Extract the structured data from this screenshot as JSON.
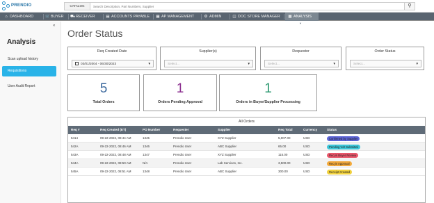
{
  "brand": {
    "name": "PRENDIO"
  },
  "search": {
    "catalog_label": "CATALOG",
    "placeholder": "Search Description, Part Numbers, Supplier"
  },
  "nav": [
    {
      "label": "DASHBOARD",
      "icon": "home-icon"
    },
    {
      "label": "BUYER",
      "icon": "cart-icon"
    },
    {
      "label": "RECEIVER",
      "icon": "truck-icon"
    },
    {
      "label": "ACCOUNTS PAYABLE",
      "icon": "invoice-icon"
    },
    {
      "label": "AP MANAGEMENT",
      "icon": "document-icon"
    },
    {
      "label": "ADMIN",
      "icon": "gear-icon"
    },
    {
      "label": "DOC STORE MANAGER",
      "icon": "folder-icon"
    },
    {
      "label": "ANALYSIS",
      "icon": "bar-chart-icon",
      "active": true
    }
  ],
  "sidebar": {
    "title": "Analysis",
    "items": [
      {
        "label": "Scan upload history"
      },
      {
        "label": "Requisitions",
        "active": true
      },
      {
        "label": "User Audit Report"
      }
    ]
  },
  "page": {
    "title": "Order Status"
  },
  "filters": {
    "req_created_date": {
      "label": "Req Created Date",
      "value": "03/01/2004 - 06/30/2023"
    },
    "suppliers": {
      "label": "Supplier(s)",
      "placeholder": "Select..."
    },
    "requestor": {
      "label": "Requestor",
      "placeholder": "Select..."
    },
    "order_status": {
      "label": "Order Status",
      "placeholder": "Select..."
    }
  },
  "cards": [
    {
      "value": "5",
      "label": "Total Orders",
      "color": "#3d6a9e"
    },
    {
      "value": "1",
      "label": "Orders Pending Approval",
      "color": "#8b2f8f"
    },
    {
      "value": "1",
      "label": "Orders in Buyer/Supplier Processing",
      "color": "#2e9a72"
    }
  ],
  "table": {
    "caption": "All Orders",
    "columns": [
      "Req #",
      "Req Created (ET)",
      "PO Number",
      "Requester",
      "Supplier",
      "Req Total",
      "Currency",
      "Status"
    ],
    "rows": [
      {
        "req": "5414",
        "created": "09-22-2022, 08:44 AM",
        "po": "1345",
        "requester": "Prendio User",
        "supplier": "XYZ Supplier",
        "total": "5,007.00",
        "currency": "USD",
        "status": "Confirmed by Supplier",
        "status_color": "#5c64d6"
      },
      {
        "req": "542A",
        "created": "09-22-2022, 08:46 AM",
        "po": "1346",
        "requester": "Prendio User",
        "supplier": "ABC Supplier",
        "total": "65.00",
        "currency": "USD",
        "status": "Pending Vdr Submittal",
        "status_color": "#3cc6d8"
      },
      {
        "req": "543A",
        "created": "09-22-2022, 08:48 AM",
        "po": "1347",
        "requester": "Prendio User",
        "supplier": "XYZ Supplier",
        "total": "115.00",
        "currency": "USD",
        "status": "Req in Buyer Review",
        "status_color": "#e8566a"
      },
      {
        "req": "544A",
        "created": "09-22-2022, 08:50 AM",
        "po": "N/A",
        "requester": "Prendio User",
        "supplier": "Lab Services, Inc.",
        "total": "3,500.00",
        "currency": "USD",
        "status": "Req in Approval",
        "status_color": "#f3a93a"
      },
      {
        "req": "545A",
        "created": "09-22-2022, 08:51 AM",
        "po": "1348",
        "requester": "Prendio User",
        "supplier": "ABC Supplier",
        "total": "300.00",
        "currency": "USD",
        "status": "Receipt Created",
        "status_color": "#f0d03c"
      }
    ]
  }
}
